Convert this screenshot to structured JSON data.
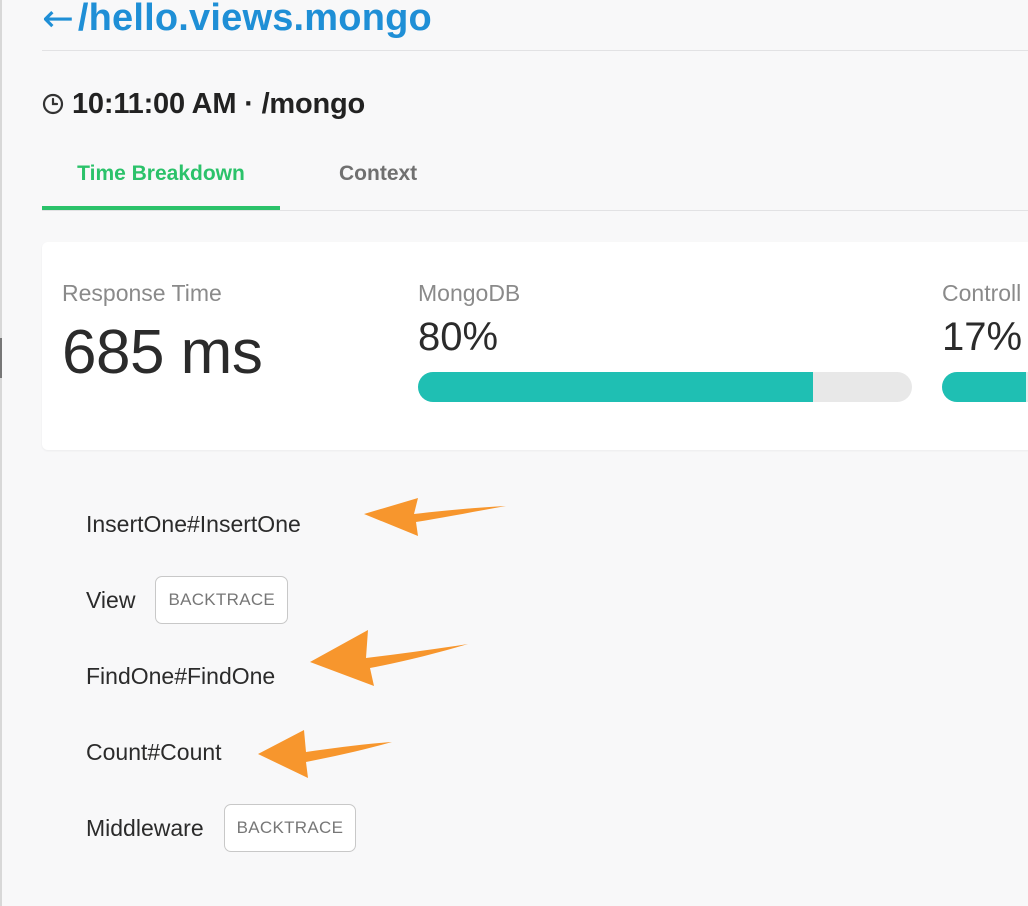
{
  "header": {
    "back_arrow": "←",
    "title": "/hello.views.mongo"
  },
  "subheader": {
    "time": "10:11:00 AM",
    "separator": "·",
    "path": "/mongo",
    "icon": "clock-icon"
  },
  "tabs": [
    {
      "label": "Time Breakdown",
      "active": true
    },
    {
      "label": "Context",
      "active": false
    }
  ],
  "metrics": {
    "response_time": {
      "label": "Response Time",
      "value": "685 ms"
    },
    "mongodb": {
      "label": "MongoDB",
      "value": "80%",
      "percent": 80
    },
    "controller": {
      "label": "Controll",
      "value": "17%",
      "percent": 17
    }
  },
  "breakdown": [
    {
      "label": "InsertOne#InsertOne",
      "button": null
    },
    {
      "label": "View",
      "button": "BACKTRACE"
    },
    {
      "label": "FindOne#FindOne",
      "button": null
    },
    {
      "label": "Count#Count",
      "button": null
    },
    {
      "label": "Middleware",
      "button": "BACKTRACE"
    }
  ],
  "colors": {
    "accent_blue": "#1f8fd6",
    "active_tab_green": "#2bc26a",
    "bar_teal": "#1fbfb3",
    "annotation_orange": "#f7962d"
  }
}
